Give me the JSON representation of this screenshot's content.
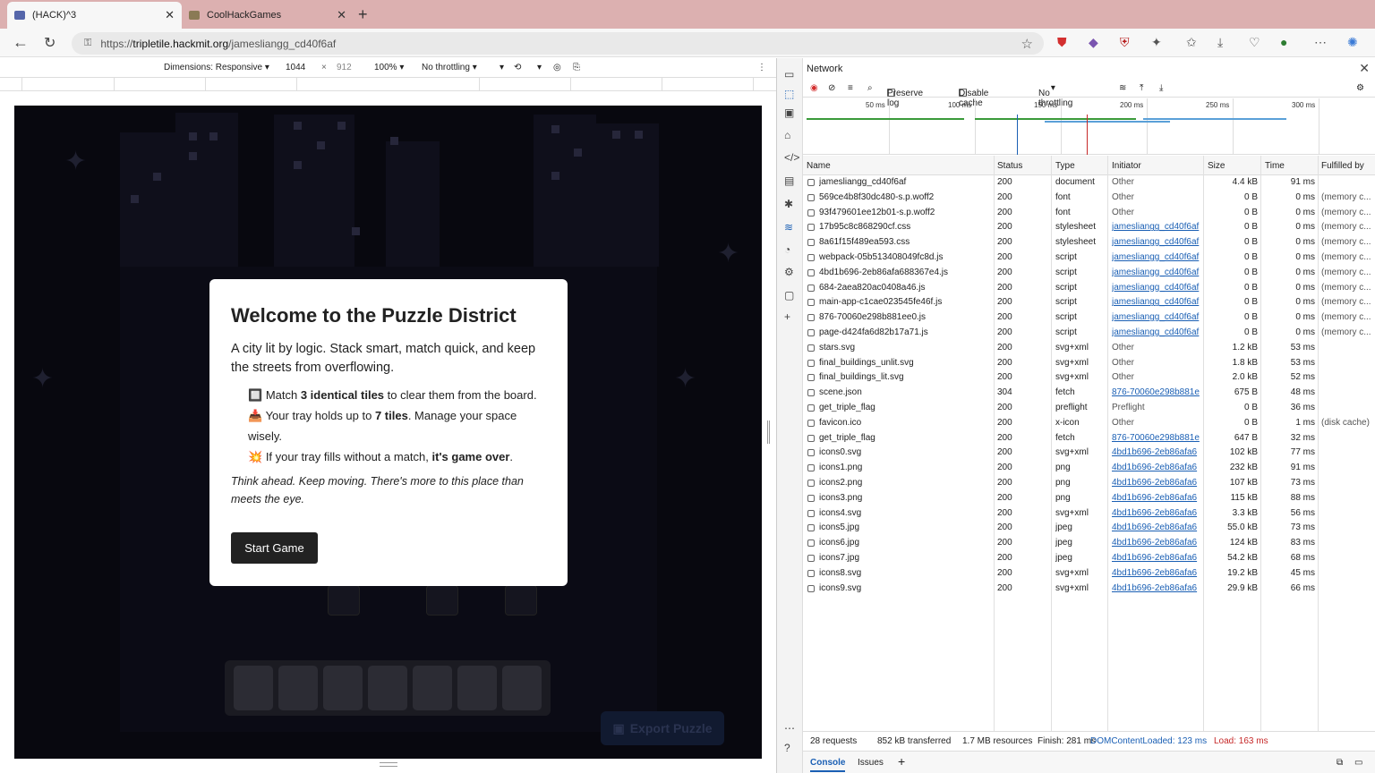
{
  "browser": {
    "tabs": [
      {
        "title": "(HACK)^3"
      },
      {
        "title": "CoolHackGames"
      }
    ],
    "url_prefix": "https://",
    "url_host": "tripletile.hackmit.org",
    "url_path": "/jamesliangg_cd40f6af"
  },
  "emulation": {
    "dimensions_label": "Dimensions: Responsive",
    "width": "1044",
    "x": "×",
    "height": "912",
    "zoom": "100%",
    "throttle": "No throttling"
  },
  "modal": {
    "title": "Welcome to the Puzzle District",
    "intro": "A city lit by logic. Stack smart, match quick, and keep the streets from overflowing.",
    "rule1_pre": "Match ",
    "rule1_bold": "3 identical tiles",
    "rule1_post": " to clear them from the board.",
    "rule2_pre": "Your tray holds up to ",
    "rule2_bold": "7 tiles",
    "rule2_post": ". Manage your space wisely.",
    "rule3_pre": "If your tray fills without a match, ",
    "rule3_bold": "it's game over",
    "rule3_post": ".",
    "note": "Think ahead. Keep moving. There's more to this place than meets the eye.",
    "start_label": "Start Game"
  },
  "game": {
    "export_label": "Export Puzzle"
  },
  "devtools": {
    "panel_title": "Network",
    "preserve_log": "Preserve log",
    "disable_cache": "Disable cache",
    "throttle": "No throttling",
    "ticks": [
      "50 ms",
      "100 ms",
      "150 ms",
      "200 ms",
      "250 ms",
      "300 ms"
    ],
    "columns": [
      "Name",
      "Status",
      "Type",
      "Initiator",
      "Size",
      "Time",
      "Fulfilled by"
    ],
    "rows": [
      {
        "name": "jamesliangg_cd40f6af",
        "status": "200",
        "type": "document",
        "initiator": "Other",
        "size": "4.4 kB",
        "time": "91 ms",
        "fulfilled": ""
      },
      {
        "name": "569ce4b8f30dc480-s.p.woff2",
        "status": "200",
        "type": "font",
        "initiator": "Other",
        "size": "0 B",
        "time": "0 ms",
        "fulfilled": "(memory c..."
      },
      {
        "name": "93f479601ee12b01-s.p.woff2",
        "status": "200",
        "type": "font",
        "initiator": "Other",
        "size": "0 B",
        "time": "0 ms",
        "fulfilled": "(memory c..."
      },
      {
        "name": "17b95c8c868290cf.css",
        "status": "200",
        "type": "stylesheet",
        "initiator": "jamesliangg_cd40f6af",
        "size": "0 B",
        "time": "0 ms",
        "fulfilled": "(memory c..."
      },
      {
        "name": "8a61f15f489ea593.css",
        "status": "200",
        "type": "stylesheet",
        "initiator": "jamesliangg_cd40f6af",
        "size": "0 B",
        "time": "0 ms",
        "fulfilled": "(memory c..."
      },
      {
        "name": "webpack-05b513408049fc8d.js",
        "status": "200",
        "type": "script",
        "initiator": "jamesliangg_cd40f6af",
        "size": "0 B",
        "time": "0 ms",
        "fulfilled": "(memory c..."
      },
      {
        "name": "4bd1b696-2eb86afa688367e4.js",
        "status": "200",
        "type": "script",
        "initiator": "jamesliangg_cd40f6af",
        "size": "0 B",
        "time": "0 ms",
        "fulfilled": "(memory c..."
      },
      {
        "name": "684-2aea820ac0408a46.js",
        "status": "200",
        "type": "script",
        "initiator": "jamesliangg_cd40f6af",
        "size": "0 B",
        "time": "0 ms",
        "fulfilled": "(memory c..."
      },
      {
        "name": "main-app-c1cae023545fe46f.js",
        "status": "200",
        "type": "script",
        "initiator": "jamesliangg_cd40f6af",
        "size": "0 B",
        "time": "0 ms",
        "fulfilled": "(memory c..."
      },
      {
        "name": "876-70060e298b881ee0.js",
        "status": "200",
        "type": "script",
        "initiator": "jamesliangg_cd40f6af",
        "size": "0 B",
        "time": "0 ms",
        "fulfilled": "(memory c..."
      },
      {
        "name": "page-d424fa6d82b17a71.js",
        "status": "200",
        "type": "script",
        "initiator": "jamesliangg_cd40f6af",
        "size": "0 B",
        "time": "0 ms",
        "fulfilled": "(memory c..."
      },
      {
        "name": "stars.svg",
        "status": "200",
        "type": "svg+xml",
        "initiator": "Other",
        "size": "1.2 kB",
        "time": "53 ms",
        "fulfilled": ""
      },
      {
        "name": "final_buildings_unlit.svg",
        "status": "200",
        "type": "svg+xml",
        "initiator": "Other",
        "size": "1.8 kB",
        "time": "53 ms",
        "fulfilled": ""
      },
      {
        "name": "final_buildings_lit.svg",
        "status": "200",
        "type": "svg+xml",
        "initiator": "Other",
        "size": "2.0 kB",
        "time": "52 ms",
        "fulfilled": ""
      },
      {
        "name": "scene.json",
        "status": "304",
        "type": "fetch",
        "initiator": "876-70060e298b881e",
        "size": "675 B",
        "time": "48 ms",
        "fulfilled": ""
      },
      {
        "name": "get_triple_flag",
        "status": "200",
        "type": "preflight",
        "initiator": "Preflight",
        "size": "0 B",
        "time": "36 ms",
        "fulfilled": ""
      },
      {
        "name": "favicon.ico",
        "status": "200",
        "type": "x-icon",
        "initiator": "Other",
        "size": "0 B",
        "time": "1 ms",
        "fulfilled": "(disk cache)"
      },
      {
        "name": "get_triple_flag",
        "status": "200",
        "type": "fetch",
        "initiator": "876-70060e298b881e",
        "size": "647 B",
        "time": "32 ms",
        "fulfilled": ""
      },
      {
        "name": "icons0.svg",
        "status": "200",
        "type": "svg+xml",
        "initiator": "4bd1b696-2eb86afa6",
        "size": "102 kB",
        "time": "77 ms",
        "fulfilled": ""
      },
      {
        "name": "icons1.png",
        "status": "200",
        "type": "png",
        "initiator": "4bd1b696-2eb86afa6",
        "size": "232 kB",
        "time": "91 ms",
        "fulfilled": ""
      },
      {
        "name": "icons2.png",
        "status": "200",
        "type": "png",
        "initiator": "4bd1b696-2eb86afa6",
        "size": "107 kB",
        "time": "73 ms",
        "fulfilled": ""
      },
      {
        "name": "icons3.png",
        "status": "200",
        "type": "png",
        "initiator": "4bd1b696-2eb86afa6",
        "size": "115 kB",
        "time": "88 ms",
        "fulfilled": ""
      },
      {
        "name": "icons4.svg",
        "status": "200",
        "type": "svg+xml",
        "initiator": "4bd1b696-2eb86afa6",
        "size": "3.3 kB",
        "time": "56 ms",
        "fulfilled": ""
      },
      {
        "name": "icons5.jpg",
        "status": "200",
        "type": "jpeg",
        "initiator": "4bd1b696-2eb86afa6",
        "size": "55.0 kB",
        "time": "73 ms",
        "fulfilled": ""
      },
      {
        "name": "icons6.jpg",
        "status": "200",
        "type": "jpeg",
        "initiator": "4bd1b696-2eb86afa6",
        "size": "124 kB",
        "time": "83 ms",
        "fulfilled": ""
      },
      {
        "name": "icons7.jpg",
        "status": "200",
        "type": "jpeg",
        "initiator": "4bd1b696-2eb86afa6",
        "size": "54.2 kB",
        "time": "68 ms",
        "fulfilled": ""
      },
      {
        "name": "icons8.svg",
        "status": "200",
        "type": "svg+xml",
        "initiator": "4bd1b696-2eb86afa6",
        "size": "19.2 kB",
        "time": "45 ms",
        "fulfilled": ""
      },
      {
        "name": "icons9.svg",
        "status": "200",
        "type": "svg+xml",
        "initiator": "4bd1b696-2eb86afa6",
        "size": "29.9 kB",
        "time": "66 ms",
        "fulfilled": ""
      }
    ],
    "summary": {
      "requests": "28 requests",
      "transferred": "852 kB transferred",
      "resources": "1.7 MB resources",
      "finish": "Finish: 281 ms",
      "dcl": "DOMContentLoaded: 123 ms",
      "load": "Load: 163 ms"
    },
    "drawer_tabs": [
      "Console",
      "Issues"
    ]
  },
  "colors": {
    "accent": "#1a5fb4",
    "dcl": "#1a5fb4",
    "load": "#c62828",
    "tab_strip": "#dcb0b0"
  }
}
